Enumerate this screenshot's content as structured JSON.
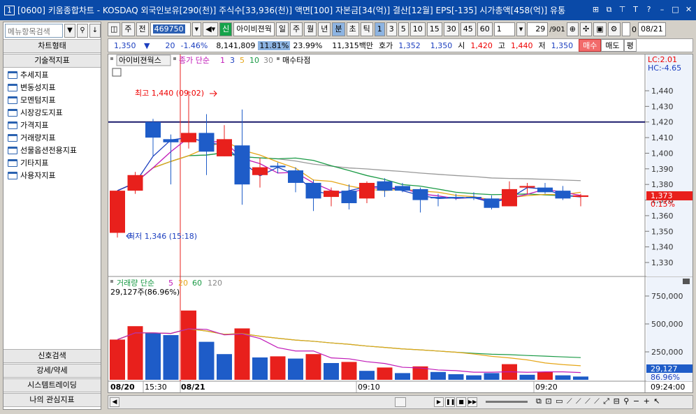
{
  "title": {
    "window_num": "1",
    "text": "[0600] 키움종합차트 - KOSDAQ 외국인보유[290(천)] 주식수[33,936(천)] 액면[100] 자본금[34(억)] 결산[12월] EPS[-135] 시가총액[458(억)] 유통"
  },
  "left": {
    "search_placeholder": "메뉴항목검색",
    "header_chart": "차트형태",
    "header_indicator": "기술적지표",
    "tree": [
      "추세지표",
      "변동성지표",
      "모멘텀지표",
      "시장강도지표",
      "가격지표",
      "거래량지표",
      "선물옵션전용지표",
      "기타지표",
      "사용자지표"
    ],
    "bottom": [
      "신호검색",
      "강세/약세",
      "시스템트레이딩",
      "나의 관심지표"
    ]
  },
  "toolbar": {
    "ju": "주",
    "jeon": "전",
    "code": "469750",
    "stock_name": "아이비젼웍",
    "periods": [
      "일",
      "주",
      "월",
      "년",
      "분",
      "초",
      "틱"
    ],
    "nums": [
      "1",
      "3",
      "5",
      "10",
      "15",
      "30",
      "45",
      "60"
    ],
    "unit": "1",
    "page": "29",
    "total": "/901",
    "date": "08/21"
  },
  "price": {
    "cur": "1,350",
    "arrow": "▼",
    "chg": "20",
    "pct": "-1.46%",
    "vol": "8,141,809",
    "turn": "11.81%",
    "rate": "23.99%",
    "amt": "11,315백만",
    "hoga_label": "호가",
    "hoga1": "1,352",
    "hoga2": "1,350",
    "open_label": "시",
    "open": "1,420",
    "high_label": "고",
    "high": "1,440",
    "low_label": "저",
    "low": "1,350",
    "buy": "매수",
    "sell": "매도",
    "eval": "평"
  },
  "chart": {
    "legend_name": "아이비젼웍스",
    "legend_ma": "종가 단순",
    "ma_periods": [
      "1",
      "3",
      "5",
      "10",
      "30"
    ],
    "legend_tail": "매수타점",
    "high_annot": "최고 1,440 (09:02)",
    "low_annot": "최저 1,346 (15:18)",
    "lc": "LC:2.01",
    "hc": "HC:-4.65",
    "last_price": "1,373",
    "last_pct": "0.15%",
    "y_ticks": [
      "1,440",
      "1,430",
      "1,420",
      "1,410",
      "1,400",
      "1,390",
      "1,380",
      "1,370",
      "1,360",
      "1,350",
      "1,340",
      "1,330"
    ],
    "vol_legend": "거래량 단순",
    "vol_periods": [
      "5",
      "20",
      "60",
      "120"
    ],
    "vol_value": "29,127주(86.96%)",
    "vol_ticks": [
      "750,000",
      "500,000",
      "250,000"
    ],
    "vol_last": "29,127",
    "vol_last_pct": "86.96%",
    "x_labels": [
      "08/20",
      "15:30",
      "08/21",
      "09:10",
      "09:20",
      "09:24:00"
    ]
  },
  "colors": {
    "up": "#e8201c",
    "down": "#1e5cc8",
    "ma5": "#e6a617",
    "ma10": "#1a9a45",
    "ma3": "#c01ab8",
    "ma1": "#1c3fbf"
  },
  "chart_data": {
    "type": "candlestick",
    "candles": [
      {
        "o": 1349,
        "h": 1372,
        "l": 1346,
        "c": 1376,
        "up": true
      },
      {
        "o": 1376,
        "h": 1388,
        "l": 1374,
        "c": 1386,
        "up": true
      },
      {
        "o": 1420,
        "h": 1422,
        "l": 1398,
        "c": 1410,
        "up": false
      },
      {
        "o": 1409,
        "h": 1412,
        "l": 1380,
        "c": 1407,
        "up": false
      },
      {
        "o": 1407,
        "h": 1440,
        "l": 1403,
        "c": 1413,
        "up": true
      },
      {
        "o": 1413,
        "h": 1425,
        "l": 1386,
        "c": 1401,
        "up": false
      },
      {
        "o": 1398,
        "h": 1418,
        "l": 1398,
        "c": 1409,
        "up": true
      },
      {
        "o": 1405,
        "h": 1428,
        "l": 1367,
        "c": 1380,
        "up": false
      },
      {
        "o": 1386,
        "h": 1397,
        "l": 1378,
        "c": 1391,
        "up": true
      },
      {
        "o": 1392,
        "h": 1394,
        "l": 1387,
        "c": 1391,
        "up": false
      },
      {
        "o": 1389,
        "h": 1391,
        "l": 1375,
        "c": 1381,
        "up": false
      },
      {
        "o": 1381,
        "h": 1383,
        "l": 1363,
        "c": 1371,
        "up": false
      },
      {
        "o": 1372,
        "h": 1378,
        "l": 1366,
        "c": 1376,
        "up": true
      },
      {
        "o": 1368,
        "h": 1380,
        "l": 1364,
        "c": 1376,
        "up": false
      },
      {
        "o": 1371,
        "h": 1382,
        "l": 1368,
        "c": 1381,
        "up": true
      },
      {
        "o": 1382,
        "h": 1384,
        "l": 1372,
        "c": 1376,
        "up": false
      },
      {
        "o": 1379,
        "h": 1381,
        "l": 1375,
        "c": 1376,
        "up": false
      },
      {
        "o": 1377,
        "h": 1378,
        "l": 1362,
        "c": 1370,
        "up": false
      },
      {
        "o": 1372,
        "h": 1374,
        "l": 1366,
        "c": 1372,
        "up": false
      },
      {
        "o": 1372,
        "h": 1374,
        "l": 1370,
        "c": 1371,
        "up": false
      },
      {
        "o": 1372,
        "h": 1375,
        "l": 1370,
        "c": 1372,
        "up": false
      },
      {
        "o": 1371,
        "h": 1373,
        "l": 1364,
        "c": 1365,
        "up": false
      },
      {
        "o": 1366,
        "h": 1382,
        "l": 1366,
        "c": 1377,
        "up": true
      },
      {
        "o": 1378,
        "h": 1381,
        "l": 1374,
        "c": 1379,
        "up": true
      },
      {
        "o": 1378,
        "h": 1381,
        "l": 1374,
        "c": 1375,
        "up": false
      },
      {
        "o": 1376,
        "h": 1379,
        "l": 1370,
        "c": 1371,
        "up": false
      },
      {
        "o": 1372,
        "h": 1374,
        "l": 1366,
        "c": 1373,
        "up": true
      }
    ],
    "volumes": [
      360000,
      480000,
      420000,
      400000,
      620000,
      340000,
      230000,
      460000,
      200000,
      210000,
      190000,
      230000,
      150000,
      160000,
      80000,
      110000,
      60000,
      120000,
      70000,
      50000,
      40000,
      60000,
      140000,
      45000,
      70000,
      40000,
      29127
    ],
    "vol_up": [
      true,
      true,
      false,
      false,
      true,
      false,
      false,
      true,
      false,
      true,
      false,
      true,
      false,
      true,
      false,
      true,
      false,
      true,
      false,
      false,
      false,
      false,
      true,
      false,
      true,
      false,
      false
    ],
    "resistance": 1420
  }
}
